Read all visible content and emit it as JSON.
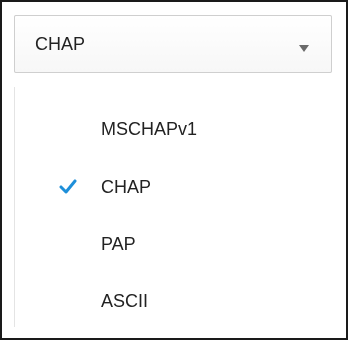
{
  "select": {
    "value": "CHAP",
    "caret_icon": "caret-down-icon"
  },
  "options": [
    {
      "label": "MSCHAPv1",
      "selected": false
    },
    {
      "label": "CHAP",
      "selected": true
    },
    {
      "label": "PAP",
      "selected": false
    },
    {
      "label": "ASCII",
      "selected": false
    }
  ],
  "colors": {
    "checkmark": "#1e8fd9",
    "text": "#222222",
    "frame": "#1a1a1a",
    "header_border": "#cfcfcf"
  }
}
